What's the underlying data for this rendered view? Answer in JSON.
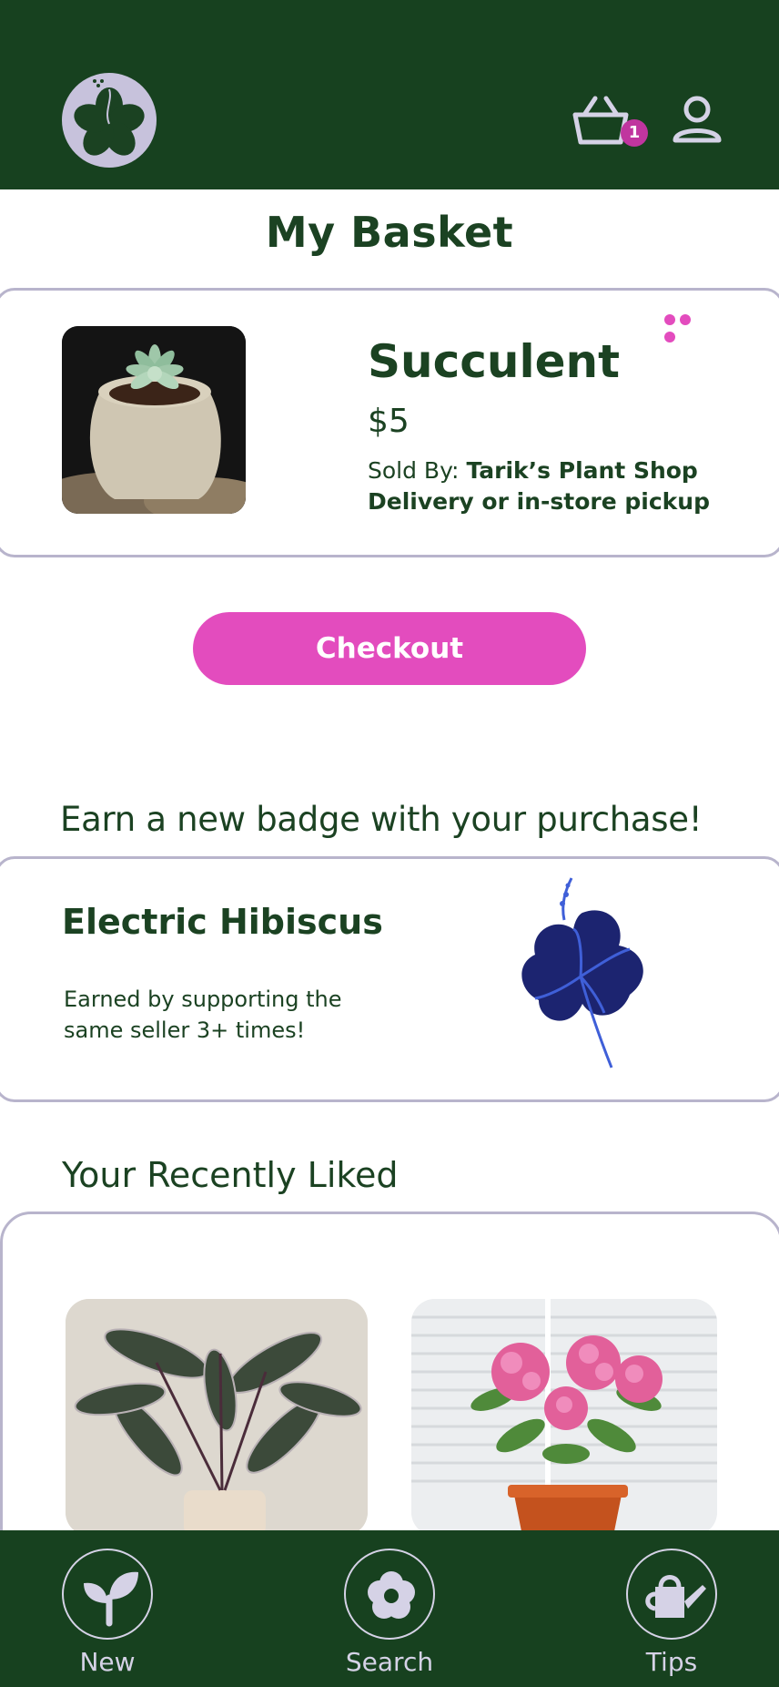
{
  "header": {
    "logo_icon": "flower-logo-icon",
    "basket_icon": "basket-icon",
    "basket_count": "1",
    "profile_icon": "user-icon",
    "background_color": "#17411f"
  },
  "page": {
    "title": "My Basket"
  },
  "cart": {
    "items": [
      {
        "name": "Succulent",
        "price": "$5",
        "sold_by_label": "Sold By:",
        "seller": "Tarik’s Plant Shop",
        "fulfillment": "Delivery or in-store pickup",
        "more_icon": "more-dots-icon"
      }
    ],
    "checkout_label": "Checkout",
    "accent_color": "#e34cbe"
  },
  "badge_section": {
    "heading": "Earn a new badge with your purchase!",
    "badge_name": "Electric Hibiscus",
    "badge_description": "Earned by supporting the same seller 3+ times!",
    "badge_icon": "hibiscus-icon"
  },
  "recently_liked": {
    "heading": "Your Recently Liked",
    "items": [
      {
        "image": "calathea-plant-photo"
      },
      {
        "image": "pink-hydrangea-photo"
      }
    ]
  },
  "bottom_nav": {
    "items": [
      {
        "label": "New",
        "icon": "sprout-icon"
      },
      {
        "label": "Search",
        "icon": "flower-search-icon"
      },
      {
        "label": "Tips",
        "icon": "watering-can-icon"
      }
    ]
  }
}
